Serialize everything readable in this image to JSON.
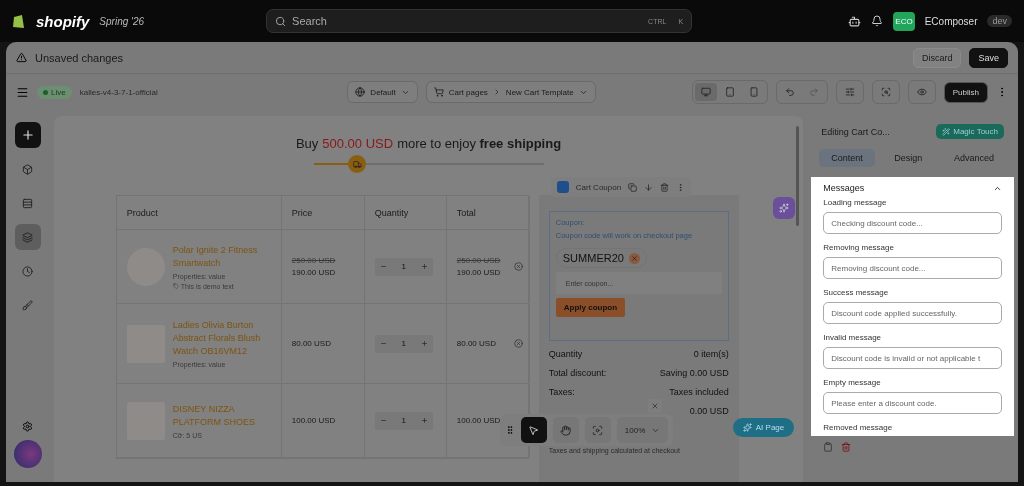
{
  "topbar": {
    "brand": "shopify",
    "badge": "Spring '26",
    "search": {
      "placeholder": "Search",
      "keys": [
        "CTRL",
        "K"
      ]
    },
    "store_badge": "ECO",
    "store": "EComposer",
    "store_tag": "dev"
  },
  "unsaved_bar": {
    "title": "Unsaved changes",
    "buttons": [
      {
        "label": "Discard",
        "kind": "secondary"
      },
      {
        "label": "Save",
        "kind": "primary"
      }
    ]
  },
  "toolbar": {
    "status": "Live",
    "page_handle": "kalles-v4-3-7-1-official",
    "locale": "Default",
    "breadcrumb": [
      "Cart pages",
      "New Cart Template"
    ],
    "devices": [
      {
        "kind": "desktop",
        "selected": true
      },
      {
        "kind": "tablet",
        "selected": false
      },
      {
        "kind": "mobile",
        "selected": false
      }
    ],
    "publish": "Publish"
  },
  "sidebar": {
    "items": [
      {
        "kind": "add",
        "selected": false
      },
      {
        "kind": "box",
        "selected": false
      },
      {
        "kind": "sections",
        "selected": false
      },
      {
        "kind": "layers",
        "selected": true
      },
      {
        "kind": "history",
        "selected": false
      },
      {
        "kind": "brush",
        "selected": false
      }
    ]
  },
  "canvas": {
    "shipping": {
      "prefix": "Buy",
      "amount": "500.00 USD",
      "suffix": "more to enjoy **free shipping**",
      "level": 0.15
    },
    "table": {
      "columns": [
        "Product",
        "Price",
        "Quantity",
        "Total"
      ],
      "rows": [
        {
          "name": "Polar Ignite 2 Fitness Smartwatch",
          "properties": "Properties: value",
          "note": "This is demo text",
          "price_old": "250.00 USD",
          "price": "190.00 USD",
          "quantity": "1",
          "total_old": "250.00 USD",
          "total": "190.00 USD",
          "removable": true
        },
        {
          "name": "Ladies Olivia Burton Abstract Florals Blush Watch OB16VM12",
          "properties": "Properties: value",
          "price": "80.00 USD",
          "quantity": "1",
          "total": "80.00 USD",
          "removable": true
        },
        {
          "name": "DISNEY NIZZA PLATFORM SHOES",
          "properties": "Cỡ: 5 US",
          "price": "100.00 USD",
          "quantity": "1",
          "total": "100.00 USD"
        }
      ]
    },
    "coupon": {
      "element_label": "Cart Coupon",
      "title": "Coupon:",
      "hint": "Coupon code will work on checkout page",
      "code": "SUMMER20",
      "placeholder": "Enter coupon...",
      "button": "Apply coupon"
    },
    "summary": [
      {
        "label": "Quantity",
        "value": "0 item(s)"
      },
      {
        "label": "Total discount:",
        "value": "Saving 0.00 USD"
      },
      {
        "label": "Taxes:",
        "value": "Taxes included"
      },
      {
        "value": "0.00 USD"
      }
    ],
    "summary_note": "Taxes and shipping calculated at checkout",
    "zoom_toolbar": {
      "tools": [
        {
          "kind": "select",
          "selected": true
        },
        {
          "kind": "hand",
          "selected": false
        },
        {
          "kind": "focus",
          "selected": false
        }
      ],
      "zoom": "100%"
    },
    "ai_button": "AI Page"
  },
  "panel": {
    "title": "Editing Cart Co...",
    "magic": "Magic Touch",
    "tabs": [
      {
        "label": "Content",
        "selected": true
      },
      {
        "label": "Design",
        "selected": false
      },
      {
        "label": "Advanced",
        "selected": false
      }
    ],
    "section": {
      "title": "Messages",
      "expanded": true,
      "fields": [
        {
          "label": "Loading message",
          "placeholder": "Checking discount code..."
        },
        {
          "label": "Removing message",
          "placeholder": "Removing discount code..."
        },
        {
          "label": "Success message",
          "placeholder": "Discount code applied successfully."
        },
        {
          "label": "Invalid message",
          "placeholder": "Discount code is invalid or not applicable t"
        },
        {
          "label": "Empty message",
          "placeholder": "Please enter a discount code."
        }
      ],
      "next_label": "Removed message"
    }
  }
}
